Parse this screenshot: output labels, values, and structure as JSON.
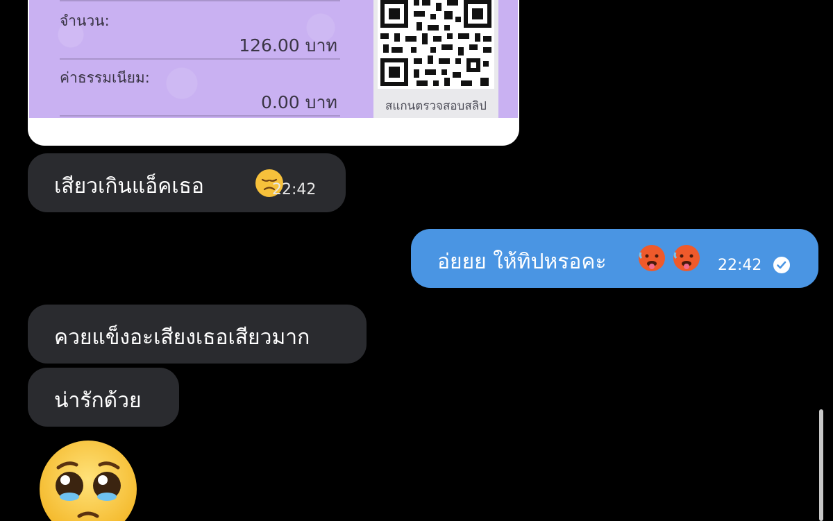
{
  "slip": {
    "amount_label": "จำนวน:",
    "amount_value": "126.00 บาท",
    "fee_label": "ค่าธรรมเนียม:",
    "fee_value": "0.00 บาท",
    "qr_caption": "สแกนตรวจสอบสลิป"
  },
  "messages": [
    {
      "id": "m1",
      "direction": "in",
      "text": "เสียวเกินแอ็คเธอ",
      "emoji": "disappointed-face",
      "time": "22:42"
    },
    {
      "id": "m2",
      "direction": "out",
      "text": "อ่ยยย ให้ทิปหรอคะ",
      "emoji": "hot-face",
      "time": "22:42",
      "read": true
    },
    {
      "id": "m3",
      "direction": "in",
      "text": "ควยแข็งอะเสียงเธอเสียวมาก"
    },
    {
      "id": "m4",
      "direction": "in",
      "text": "น่ารักด้วย"
    },
    {
      "id": "m5",
      "direction": "in",
      "emoji": "pleading-face"
    }
  ],
  "colors": {
    "background": "#000000",
    "incoming_bubble": "#2a2b2f",
    "outgoing_bubble": "#4a95e3",
    "slip_purple": "#c9b1f2"
  }
}
